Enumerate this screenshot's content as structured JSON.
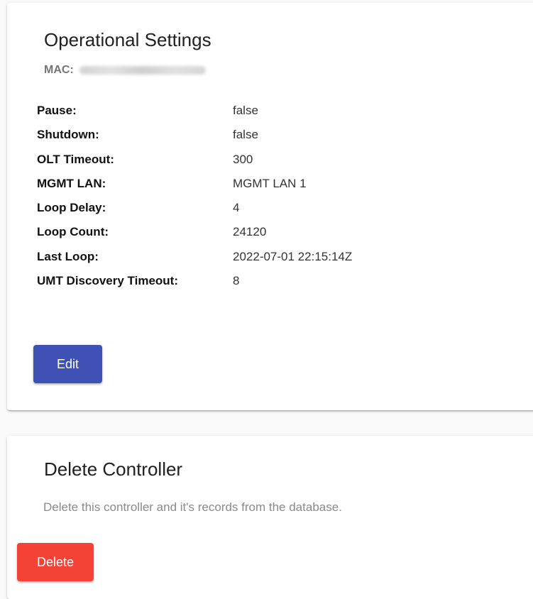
{
  "settings": {
    "title": "Operational Settings",
    "mac_label": "MAC:",
    "properties": [
      {
        "label": "Pause:",
        "value": "false"
      },
      {
        "label": "Shutdown:",
        "value": "false"
      },
      {
        "label": "OLT Timeout:",
        "value": "300"
      },
      {
        "label": "MGMT LAN:",
        "value": "MGMT LAN 1"
      },
      {
        "label": "Loop Delay:",
        "value": "4"
      },
      {
        "label": "Loop Count:",
        "value": "24120"
      },
      {
        "label": "Last Loop:",
        "value": "2022-07-01 22:15:14Z"
      },
      {
        "label": "UMT Discovery Timeout:",
        "value": "8"
      }
    ],
    "edit_label": "Edit"
  },
  "delete": {
    "title": "Delete Controller",
    "description": "Delete this controller and it's records from the database.",
    "button_label": "Delete"
  },
  "colors": {
    "primary": "#3f51b5",
    "danger": "#f44336"
  }
}
